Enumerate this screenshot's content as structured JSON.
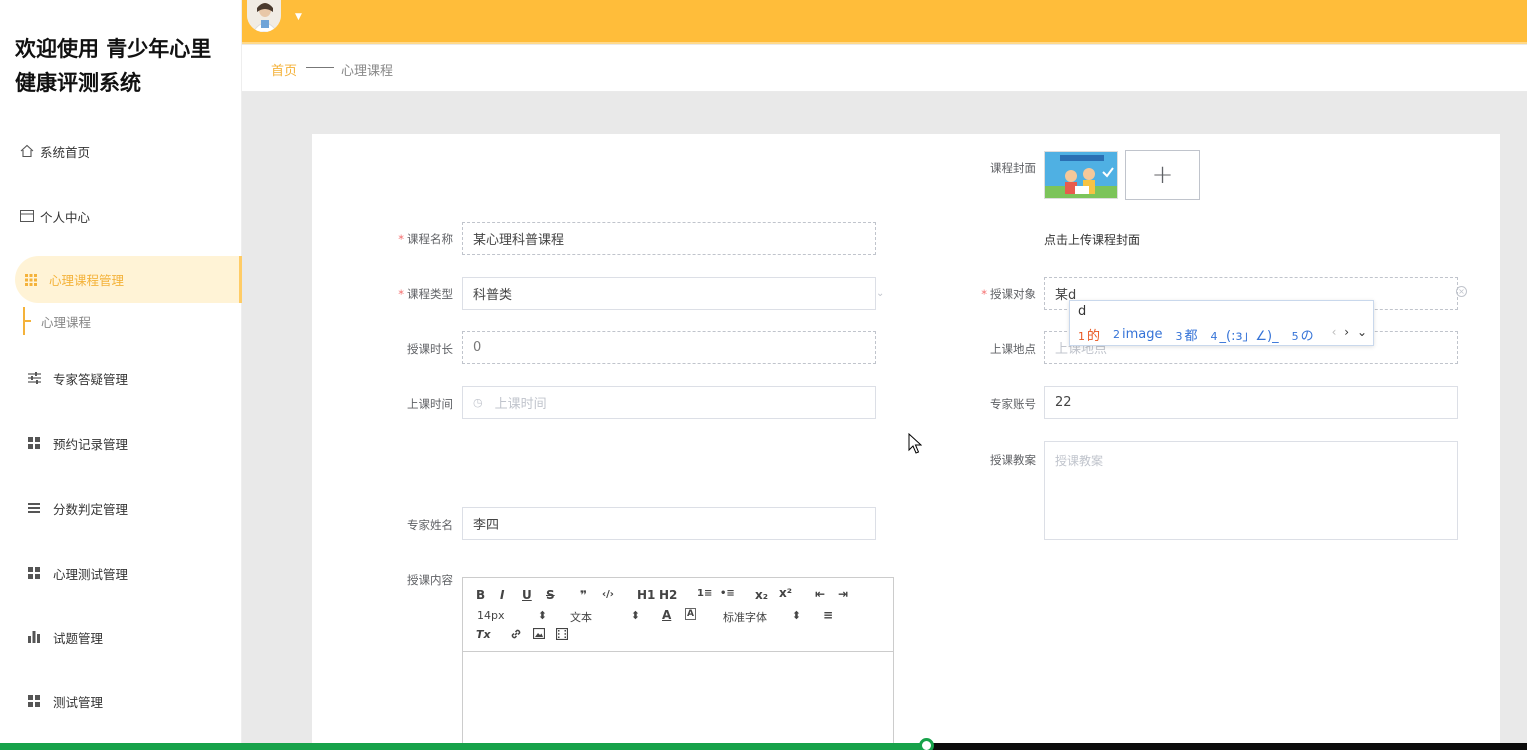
{
  "app": {
    "title": "欢迎使用 青少年心里健康评测系统"
  },
  "sidebar": {
    "items": [
      {
        "label": "系统首页",
        "icon": "home-icon"
      },
      {
        "label": "个人中心",
        "icon": "card-icon"
      },
      {
        "label": "心理课程管理",
        "icon": "grid-icon",
        "active": true
      },
      {
        "label": "专家答疑管理",
        "icon": "sliders-icon"
      },
      {
        "label": "预约记录管理",
        "icon": "grid-icon"
      },
      {
        "label": "分数判定管理",
        "icon": "list-icon"
      },
      {
        "label": "心理测试管理",
        "icon": "grid-icon"
      },
      {
        "label": "试题管理",
        "icon": "bar-chart-icon"
      },
      {
        "label": "测试管理",
        "icon": "grid-icon"
      }
    ],
    "sub_item": "心理课程"
  },
  "breadcrumb": {
    "home": "首页",
    "current": "心理课程"
  },
  "form": {
    "course_name": {
      "label": "课程名称",
      "value": "某心理科普课程"
    },
    "course_type": {
      "label": "课程类型",
      "value": "科普类"
    },
    "duration": {
      "label": "授课时长",
      "value": "0"
    },
    "class_time": {
      "label": "上课时间",
      "placeholder": "上课时间"
    },
    "expert_name": {
      "label": "专家姓名",
      "value": "李四"
    },
    "content": {
      "label": "授课内容"
    },
    "cover": {
      "label": "课程封面",
      "hint": "点击上传课程封面",
      "add": "+"
    },
    "audience": {
      "label": "授课对象",
      "value": "某d"
    },
    "location": {
      "label": "上课地点",
      "placeholder": "上课地点"
    },
    "expert_account": {
      "label": "专家账号",
      "value": "22"
    },
    "lesson_plan": {
      "label": "授课教案",
      "placeholder": "授课教案"
    }
  },
  "ime": {
    "composition": "d",
    "candidates": [
      {
        "n": "1",
        "text": "的"
      },
      {
        "n": "2",
        "text": "image"
      },
      {
        "n": "3",
        "text": "都"
      },
      {
        "n": "4",
        "text": "_(:з」∠)_"
      },
      {
        "n": "5",
        "text": "の"
      }
    ],
    "nav_prev": "‹",
    "nav_next": "›",
    "nav_more": "⌄"
  },
  "editor": {
    "toolbar": {
      "bold": "B",
      "italic": "I",
      "underline": "U",
      "strike": "S",
      "quote": "❞",
      "code": "‹/›",
      "h1": "H1",
      "h2": "H2",
      "ol": "1≡",
      "ul": "•≡",
      "sub": "x₂",
      "sup": "x²",
      "outdent": "⇤",
      "indent": "⇥",
      "size": "14px",
      "format": "文本",
      "font": "标准字体",
      "color": "A",
      "bg": "A",
      "align": "≡",
      "clear": "Tx",
      "link": "🔗",
      "image": "▣",
      "video": "▤"
    }
  },
  "colors": {
    "accent": "#ffbd3a",
    "active": "#f4b23a",
    "required": "#f56c6c"
  }
}
